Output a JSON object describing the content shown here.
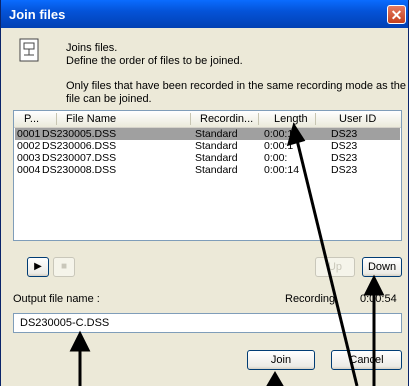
{
  "window": {
    "title": "Join files",
    "close_glyph": "✕"
  },
  "info": {
    "line1": "Joins files.",
    "line2": "Define the order of files to be joined.",
    "note1": "Only files that have been recorded in the same recording mode as the first",
    "note2": "file can be joined."
  },
  "table": {
    "columns": [
      "P...",
      "File Name",
      "Recordin...",
      "Length",
      "User ID"
    ],
    "rows": [
      {
        "p": "0001",
        "file": "DS230005.DSS",
        "mode": "Standard",
        "length": "0:00:13",
        "user": "DS23",
        "selected": true
      },
      {
        "p": "0002",
        "file": "DS230006.DSS",
        "mode": "Standard",
        "length": "0:00:1",
        "user": "DS23",
        "selected": false
      },
      {
        "p": "0003",
        "file": "DS230007.DSS",
        "mode": "Standard",
        "length": "0:00:",
        "user": "DS23",
        "selected": false
      },
      {
        "p": "0004",
        "file": "DS230008.DSS",
        "mode": "Standard",
        "length": "0:00:14",
        "user": "DS23",
        "selected": false
      }
    ]
  },
  "controls": {
    "play_glyph": "▶",
    "stop_glyph": "■",
    "up_label": "Up",
    "down_label": "Down"
  },
  "output": {
    "label": "Output file name :",
    "status_text": "Recording",
    "time_text": "0:00:54",
    "value": "DS230005-C.DSS"
  },
  "buttons": {
    "join": "Join",
    "cancel": "Cancel"
  },
  "icons": {
    "doc": "document-icon",
    "close": "close-icon"
  },
  "colors": {
    "title_bar": "#0453d8",
    "selected_row": "#a0a0a0",
    "dialog_bg": "#ece9d8"
  }
}
